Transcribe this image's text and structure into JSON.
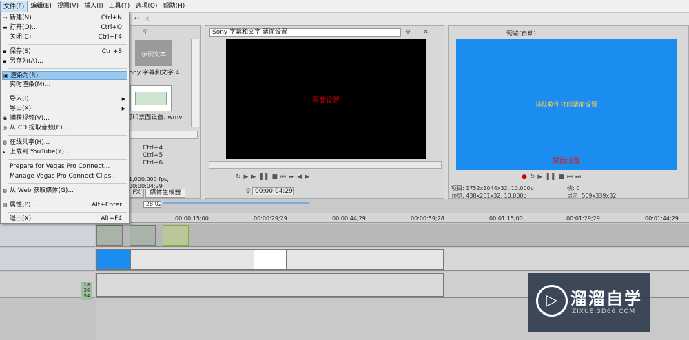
{
  "menubar": {
    "items": [
      "文件(F)",
      "编辑(E)",
      "视图(V)",
      "插入(I)",
      "工具(T)",
      "选项(O)",
      "帮助(H)"
    ]
  },
  "file_menu": {
    "items": [
      {
        "label": "新建(N)...",
        "shortcut": "Ctrl+N"
      },
      {
        "label": "打开(O)...",
        "shortcut": "Ctrl+O"
      },
      {
        "label": "关闭(C)",
        "shortcut": "Ctrl+F4"
      },
      {
        "label": "保存(S)",
        "shortcut": "Ctrl+S"
      },
      {
        "label": "另存为(A)...",
        "shortcut": ""
      },
      {
        "label": "渲染为(R)...",
        "shortcut": ""
      },
      {
        "label": "实时渲染(M)...",
        "shortcut": ""
      },
      {
        "label": "导入(I)",
        "shortcut": ""
      },
      {
        "label": "导出(X)",
        "shortcut": ""
      },
      {
        "label": "捕获视频(V)...",
        "shortcut": ""
      },
      {
        "label": "从 CD 提取音频(E)...",
        "shortcut": ""
      },
      {
        "label": "在线共享(H)...",
        "shortcut": ""
      },
      {
        "label": "上载到 YouTube(Y)...",
        "shortcut": ""
      },
      {
        "label": "Prepare for Vegas Pro Connect...",
        "shortcut": ""
      },
      {
        "label": "Manage Vegas Pro Connect Clips...",
        "shortcut": ""
      },
      {
        "label": "从 Web 获取媒体(G)...",
        "shortcut": ""
      },
      {
        "label": "属性(P)...",
        "shortcut": "Alt+Enter"
      },
      {
        "label": "退出(X)",
        "shortcut": "Alt+F4"
      }
    ]
  },
  "explorer": {
    "thumb1_text": "示例文本",
    "thumb1_caption": "ony 字幕和文字 4",
    "thumb2_caption": "打印票面设置. wmv",
    "recent": [
      "Ctrl+4",
      "Ctrl+5",
      "Ctrl+6"
    ],
    "fps_text": "1,000.000 fps, 00:00:04;29",
    "tabs": [
      "FX",
      "媒体生成器"
    ]
  },
  "preview_left": {
    "title": "Sony 字幕和文字 票面设置",
    "screen_text": "票面设置",
    "timecode": "00:00:04;29"
  },
  "preview_right": {
    "mode": "预览(自动)",
    "screen_text": "排队软件打印票面设置",
    "sub_text": "票面设置",
    "project_label": "项目:",
    "project_value": "1752x1044x32, 10.000p",
    "preview_label": "预览:",
    "preview_value": "438x261x32, 10.000p",
    "frame_label": "帧:",
    "frame_value": "0",
    "display_label": "显示:",
    "display_value": "569x339x32"
  },
  "timeline": {
    "position": "-28;02",
    "ruler": [
      "00:00:15;00",
      "00:00:29;29",
      "00:00:44;29",
      "00:00:59;28",
      "00:01:15;00",
      "00:01:29;29",
      "00:01:44;29"
    ],
    "meter": [
      "18",
      "36",
      "54"
    ]
  },
  "watermark": {
    "title": "溜溜自学",
    "subtitle": "ZIXUE.3D66.COM"
  },
  "colors": {
    "accent": "#1b8cf0",
    "menu_highlight": "#99c9ef",
    "preview_black": "#000000"
  }
}
